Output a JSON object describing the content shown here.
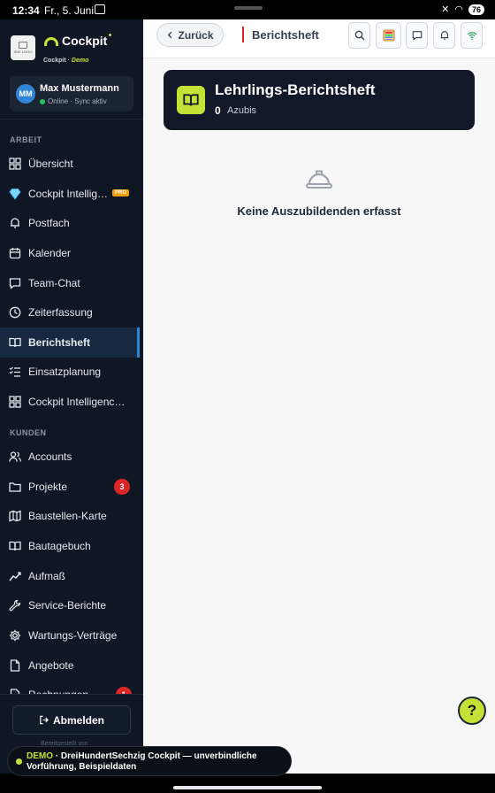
{
  "status_bar": {
    "time": "12:34",
    "date": "Fr., 5. Juni",
    "battery": "76"
  },
  "sidebar": {
    "brand": {
      "logo_text": "SHE LOGO",
      "name": "Cockpit",
      "sub_prefix": "Cockpit · ",
      "sub_demo": "Demo"
    },
    "user": {
      "initials": "MM",
      "name": "Max Mustermann",
      "status": "Online · Sync aktiv"
    },
    "section_work": "ARBEIT",
    "work_items": [
      {
        "label": "Übersicht",
        "icon": "grid-icon"
      },
      {
        "label": "Cockpit Intellig…",
        "icon": "diamond-icon",
        "badge": "PRO"
      },
      {
        "label": "Postfach",
        "icon": "bell-icon"
      },
      {
        "label": "Kalender",
        "icon": "calendar-icon"
      },
      {
        "label": "Team-Chat",
        "icon": "chat-icon"
      },
      {
        "label": "Zeiterfassung",
        "icon": "clock-icon"
      },
      {
        "label": "Berichtsheft",
        "icon": "book-icon",
        "active": true
      },
      {
        "label": "Einsatzplanung",
        "icon": "checklist-icon"
      },
      {
        "label": "Cockpit Intelligenc…",
        "icon": "grid-icon"
      }
    ],
    "section_customers": "KUNDEN",
    "customer_items": [
      {
        "label": "Accounts",
        "icon": "users-icon"
      },
      {
        "label": "Projekte",
        "icon": "folder-icon",
        "count": "3"
      },
      {
        "label": "Baustellen-Karte",
        "icon": "map-icon"
      },
      {
        "label": "Bautagebuch",
        "icon": "book-icon"
      },
      {
        "label": "Aufmaß",
        "icon": "chart-icon"
      },
      {
        "label": "Service-Berichte",
        "icon": "wrench-icon"
      },
      {
        "label": "Wartungs-Verträge",
        "icon": "gear-icon"
      },
      {
        "label": "Angebote",
        "icon": "document-icon"
      },
      {
        "label": "Rechnungen",
        "icon": "invoice-icon",
        "count": "1"
      }
    ],
    "logout_label": "Abmelden",
    "powered_by": "Bereitgestellt von"
  },
  "topbar": {
    "back_label": "Zurück",
    "title": "Berichtsheft",
    "icons": [
      "search-icon",
      "calculator-icon",
      "chat-icon",
      "bell-icon",
      "wifi-icon"
    ]
  },
  "hero": {
    "title": "Lehrlings-Berichtsheft",
    "count": "0",
    "unit": "Azubis"
  },
  "empty_state": {
    "text": "Keine Auszubildenden erfasst"
  },
  "help_label": "?",
  "demo_banner": {
    "tag": "DEMO",
    "line1": " · DreiHundertSechzig Cockpit — unverbindliche",
    "line2": "Vorführung, Beispieldaten"
  },
  "colors": {
    "sidebar_bg": "#0f1724",
    "accent_lime": "#c6e135",
    "active_bg": "#172841",
    "badge_red": "#dc2626",
    "pro_orange": "#f59e0b"
  }
}
